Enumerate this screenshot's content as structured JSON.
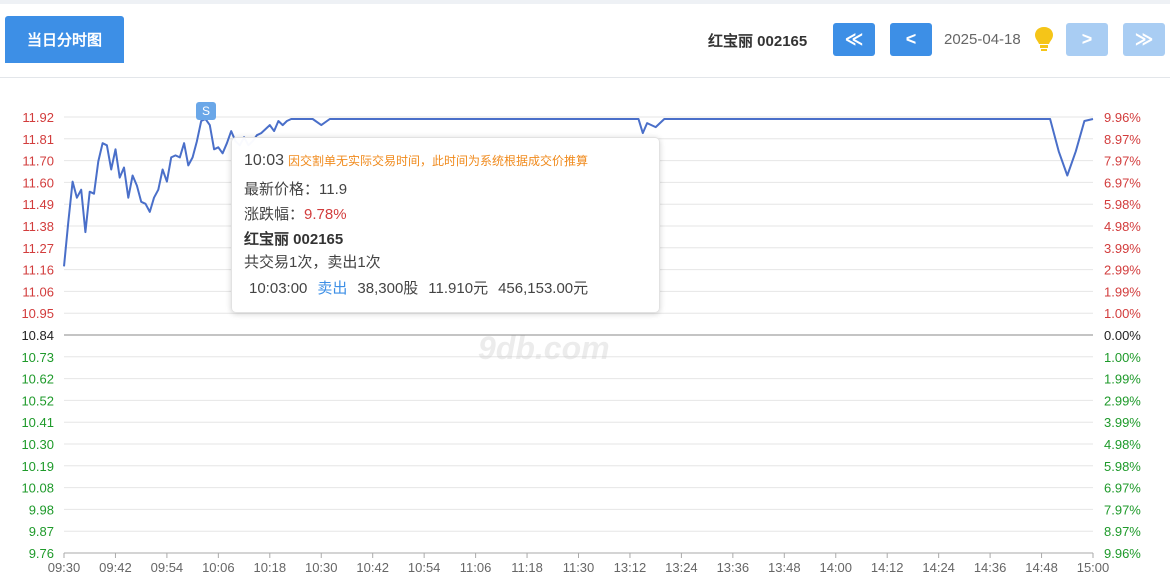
{
  "tab_label": "当日分时图",
  "stock_label": "红宝丽 002165",
  "date": "2025-04-18",
  "nav": {
    "first": "≪",
    "prev": "<",
    "next": ">",
    "last": "≫"
  },
  "watermark": "9db.com",
  "marker_label": "S",
  "tooltip": {
    "time": "10:03",
    "note": "因交割单无实际交易时间，此时间为系统根据成交价推算",
    "price_label": "最新价格：",
    "price_value": "11.9",
    "change_label": "涨跌幅：",
    "change_value": "9.78%",
    "name": "红宝丽 002165",
    "summary": "共交易1次，卖出1次",
    "trade": {
      "time": "10:03:00",
      "action": "卖出",
      "volume": "38,300股",
      "price": "11.910元",
      "amount": "456,153.00元"
    }
  },
  "colors": {
    "up": "#d23c3c",
    "down": "#1e9a2a",
    "neutral": "#222222",
    "line": "#4a6fc9",
    "accent": "#3d8fe6"
  },
  "chart_data": {
    "type": "line",
    "y_ticks": [
      "11.92",
      "11.81",
      "11.70",
      "11.60",
      "11.49",
      "11.38",
      "11.27",
      "11.16",
      "11.06",
      "10.95",
      "10.84",
      "10.73",
      "10.62",
      "10.52",
      "10.41",
      "10.30",
      "10.19",
      "10.08",
      "9.98",
      "9.87",
      "9.76"
    ],
    "y_pct_ticks": [
      "9.96%",
      "8.97%",
      "7.97%",
      "6.97%",
      "5.98%",
      "4.98%",
      "3.99%",
      "2.99%",
      "1.99%",
      "1.00%",
      "0.00%",
      "1.00%",
      "1.99%",
      "2.99%",
      "3.99%",
      "4.98%",
      "5.98%",
      "6.97%",
      "7.97%",
      "8.97%",
      "9.96%"
    ],
    "x_ticks": [
      "09:30",
      "09:42",
      "09:54",
      "10:06",
      "10:18",
      "10:30",
      "10:42",
      "10:54",
      "11:06",
      "11:18",
      "11:30",
      "13:12",
      "13:24",
      "13:36",
      "13:48",
      "14:00",
      "14:12",
      "14:24",
      "14:36",
      "14:48",
      "15:00"
    ],
    "prev_close": 10.84,
    "ylim": [
      9.76,
      11.92
    ],
    "series": [
      {
        "x": [
          0,
          1,
          2,
          3,
          4,
          5,
          6,
          7,
          8,
          9,
          10,
          11,
          12,
          13,
          14,
          15,
          16,
          17,
          18,
          19,
          20,
          21,
          22,
          23,
          24,
          25,
          26,
          27,
          28,
          29,
          30,
          31,
          32,
          33,
          34,
          35,
          36,
          37,
          38,
          39,
          40,
          41,
          42,
          43,
          44,
          45,
          46,
          47,
          48,
          49,
          50,
          51,
          52,
          53,
          55,
          58,
          60,
          62,
          64,
          66,
          68,
          70,
          120,
          134,
          135,
          136,
          138,
          140,
          142,
          200,
          230,
          232,
          234,
          236,
          238,
          240
        ],
        "y": [
          11.18,
          11.4,
          11.6,
          11.52,
          11.56,
          11.35,
          11.55,
          11.54,
          11.7,
          11.79,
          11.78,
          11.66,
          11.76,
          11.62,
          11.67,
          11.52,
          11.63,
          11.58,
          11.5,
          11.49,
          11.45,
          11.52,
          11.56,
          11.66,
          11.6,
          11.72,
          11.73,
          11.72,
          11.79,
          11.68,
          11.72,
          11.8,
          11.9,
          11.91,
          11.88,
          11.76,
          11.77,
          11.74,
          11.79,
          11.85,
          11.8,
          11.78,
          11.82,
          11.78,
          11.8,
          11.83,
          11.84,
          11.86,
          11.88,
          11.85,
          11.9,
          11.88,
          11.9,
          11.91,
          11.91,
          11.91,
          11.88,
          11.91,
          11.91,
          11.91,
          11.91,
          11.91,
          11.91,
          11.91,
          11.84,
          11.89,
          11.87,
          11.91,
          11.91,
          11.91,
          11.91,
          11.75,
          11.63,
          11.75,
          11.9,
          11.91
        ]
      }
    ]
  }
}
